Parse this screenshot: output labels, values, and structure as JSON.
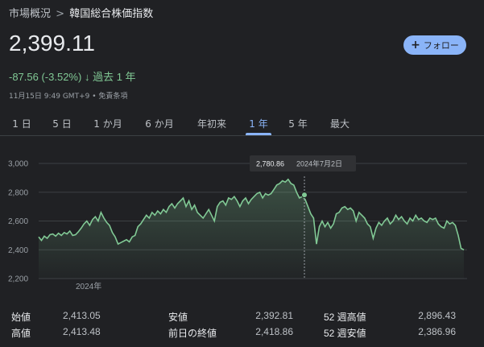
{
  "breadcrumb": {
    "parent": "市場概況",
    "separator": ">",
    "current": "韓国総合株価指数"
  },
  "quote": {
    "price": "2,399.11",
    "change": "-87.56 (-3.52%)",
    "change_arrow": "↓",
    "change_period": "過去 1 年",
    "timestamp": "11月15日 9:49 GMT+9 • 免責条項"
  },
  "follow_button": {
    "icon": "plus-icon",
    "label": "フォロー"
  },
  "tabs": [
    {
      "label": "1 日"
    },
    {
      "label": "5 日"
    },
    {
      "label": "1 か月"
    },
    {
      "label": "6 か月"
    },
    {
      "label": "年初来"
    },
    {
      "label": "1 年",
      "active": true
    },
    {
      "label": "5 年"
    },
    {
      "label": "最大"
    }
  ],
  "tooltip": {
    "value": "2,780.86",
    "date": "2024年7月2日"
  },
  "colors": {
    "line": "#81c995",
    "accent": "#8ab4f8",
    "negative": "#81c995"
  },
  "chart_data": {
    "type": "line",
    "ylim": [
      2200,
      3000
    ],
    "yticks": [
      "3,000",
      "2,800",
      "2,600",
      "2,400",
      "2,200"
    ],
    "xtick_labels": [
      "2024年"
    ],
    "grid": true,
    "series": [
      {
        "values": [
          2490,
          2465,
          2495,
          2480,
          2505,
          2510,
          2495,
          2515,
          2500,
          2520,
          2510,
          2530,
          2500,
          2505,
          2525,
          2550,
          2580,
          2600,
          2570,
          2610,
          2630,
          2600,
          2660,
          2620,
          2590,
          2570,
          2520,
          2490,
          2440,
          2450,
          2460,
          2470,
          2455,
          2490,
          2500,
          2560,
          2580,
          2610,
          2640,
          2620,
          2660,
          2640,
          2670,
          2650,
          2680,
          2660,
          2700,
          2720,
          2690,
          2720,
          2740,
          2760,
          2700,
          2740,
          2680,
          2710,
          2660,
          2640,
          2620,
          2650,
          2680,
          2640,
          2600,
          2700,
          2730,
          2740,
          2710,
          2760,
          2750,
          2770,
          2740,
          2700,
          2740,
          2760,
          2720,
          2750,
          2770,
          2790,
          2800,
          2760,
          2790,
          2780,
          2790,
          2820,
          2850,
          2860,
          2880,
          2870,
          2890,
          2860,
          2850,
          2800,
          2760,
          2770,
          2750,
          2700,
          2650,
          2620,
          2440,
          2560,
          2600,
          2560,
          2590,
          2550,
          2580,
          2650,
          2660,
          2690,
          2700,
          2680,
          2690,
          2670,
          2600,
          2660,
          2640,
          2620,
          2580,
          2560,
          2480,
          2550,
          2590,
          2570,
          2600,
          2620,
          2580,
          2600,
          2640,
          2610,
          2630,
          2600,
          2580,
          2620,
          2600,
          2640,
          2610,
          2620,
          2600,
          2590,
          2620,
          2610,
          2620,
          2580,
          2560,
          2550,
          2600,
          2580,
          2590,
          2570,
          2500,
          2410,
          2400
        ]
      }
    ]
  },
  "stats": [
    {
      "label": "始値",
      "value": "2,413.05"
    },
    {
      "label": "安値",
      "value": "2,392.81"
    },
    {
      "label": "52 週高値",
      "value": "2,896.43"
    },
    {
      "label": "高値",
      "value": "2,413.48"
    },
    {
      "label": "前日の終値",
      "value": "2,418.86"
    },
    {
      "label": "52 週安値",
      "value": "2,386.96"
    }
  ]
}
